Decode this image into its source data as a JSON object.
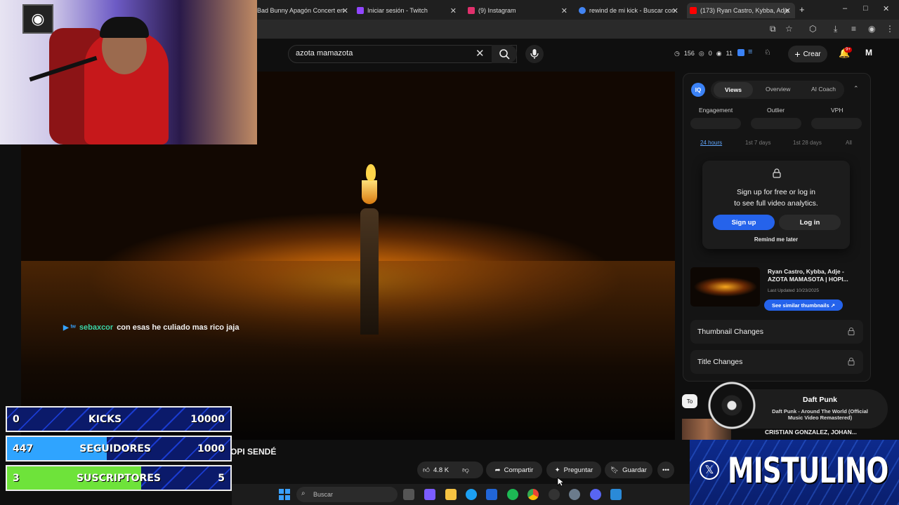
{
  "browser": {
    "tabs": [
      {
        "label": "Bad Bunny Apagón Concert en",
        "icon_color": "#ffffff"
      },
      {
        "label": "Iniciar sesión - Twitch",
        "icon_color": "#9146ff"
      },
      {
        "label": "(9) Instagram",
        "icon_color": "#e1306c"
      },
      {
        "label": "rewind de mi kick - Buscar con",
        "icon_color": "#4285f4"
      },
      {
        "label": "(173) Ryan Castro, Kybba, Adje",
        "icon_color": "#ff0000"
      }
    ],
    "new_tab": "+",
    "window_controls": [
      "–",
      "□",
      "✕"
    ]
  },
  "youtube": {
    "search": {
      "value": "azota mamazota"
    },
    "stats": {
      "a": "156",
      "b": "0",
      "c": "11"
    },
    "create_label": "Crear",
    "notification_badge": "9+",
    "video_title_visible": "OPI SENDÉ",
    "actions": {
      "likes": "4.8 K",
      "share": "Compartir",
      "ask": "Preguntar",
      "save": "Guardar"
    }
  },
  "chat": {
    "badge": "▶ ᵗʷ",
    "user": "sebaxcor",
    "message": "con esas he culiado mas rico jaja"
  },
  "counters": [
    {
      "left": "0",
      "label": "KICKS",
      "right": "10000",
      "fill_fraction": 0.0,
      "fill_color": "#1e40ff"
    },
    {
      "left": "447",
      "label": "SEGUIDORES",
      "right": "1000",
      "fill_fraction": 0.447,
      "fill_color": "#2fa4ff"
    },
    {
      "left": "3",
      "label": "SUSCRIPTORES",
      "right": "5",
      "fill_fraction": 0.6,
      "fill_color": "#6ee33a"
    }
  ],
  "vidiq": {
    "logo": "IQ",
    "tabs": [
      "Views",
      "Overview",
      "AI Coach"
    ],
    "metrics": [
      "Engagement",
      "Outlier",
      "VPH"
    ],
    "ranges": [
      "24 hours",
      "1st 7 days",
      "1st 28 days",
      "All"
    ],
    "lock_line1": "Sign up for free or log in",
    "lock_line2": "to see full video analytics.",
    "signup": "Sign up",
    "login": "Log in",
    "remind": "Remind me later",
    "thumb_title1": "Ryan Castro, Kybba, Adje -",
    "thumb_title2": "AZOTA MAMASOTA | HOPI...",
    "updated": "Last Updated 10/23/2025",
    "similar": "See similar thumbnails ↗",
    "thumbnail_changes": "Thumbnail Changes",
    "title_changes": "Title Changes"
  },
  "recommendations": {
    "chip": "To",
    "title": "CRISTIAN GONZALEZ, JOHAN..."
  },
  "now_playing": {
    "artist": "Daft Punk",
    "title1": "Daft Punk - Around The World (Official",
    "title2": "Music Video Remastered)"
  },
  "overlay": {
    "brand": "MISTULINO"
  },
  "taskbar": {
    "search_placeholder": "Buscar"
  }
}
